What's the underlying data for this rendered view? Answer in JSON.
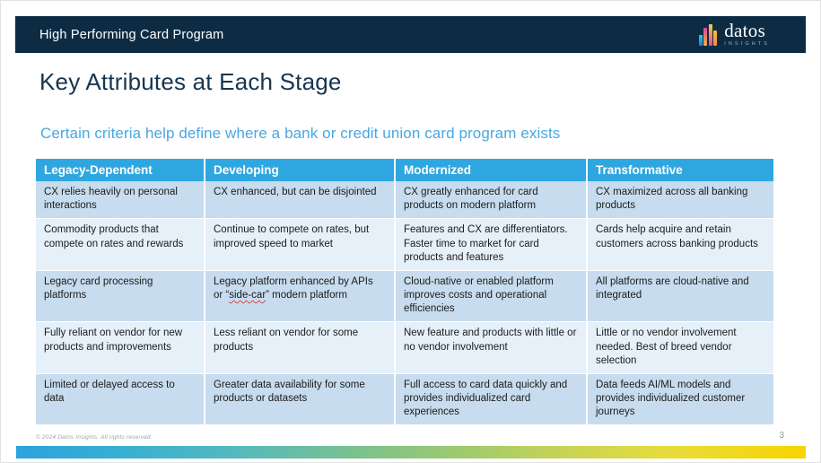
{
  "header": {
    "title": "High Performing Card Program",
    "brand_name": "datos",
    "brand_sub": "INSIGHTS"
  },
  "slide": {
    "title": "Key Attributes at Each Stage",
    "subtitle": "Certain criteria help define where a bank or credit union card program exists"
  },
  "table": {
    "columns": [
      "Legacy-Dependent",
      "Developing",
      "Modernized",
      "Transformative"
    ],
    "rows": [
      [
        "CX relies heavily on personal interactions",
        "CX enhanced, but can be disjointed",
        "CX greatly enhanced for card products on modern platform",
        "CX maximized across all banking products"
      ],
      [
        "Commodity products that compete on rates and rewards",
        "Continue to compete on rates, but improved speed to market",
        "Features and CX are differentiators. Faster time to market for card products and features",
        "Cards help acquire and retain customers across banking products"
      ],
      [
        "Legacy card processing platforms",
        "Legacy platform enhanced by APIs or “side-car” modern platform",
        "Cloud-native or enabled platform improves costs and operational efficiencies",
        "All platforms are cloud-native and integrated"
      ],
      [
        "Fully reliant on vendor for new products and improvements",
        "Less reliant on vendor for some products",
        "New feature and products with little or no vendor involvement",
        "Little or no vendor involvement needed. Best of breed vendor selection"
      ],
      [
        "Limited or delayed access to data",
        "Greater data availability for some products or datasets",
        "Full access to card data quickly and provides individualized card experiences",
        "Data feeds AI/ML models and provides individualized customer journeys"
      ]
    ],
    "spellcheck_phrase": "side-car"
  },
  "footer": {
    "copyright": "© 2024 Datos Insights. All rights reserved.",
    "page_number": "3"
  },
  "colors": {
    "header_navy": "#0d2c44",
    "accent_blue": "#2ea7e0",
    "subtitle_blue": "#4aa7e0",
    "band_dark": "#c7dcee",
    "band_light": "#e6f0f9",
    "title_navy": "#16354f"
  }
}
